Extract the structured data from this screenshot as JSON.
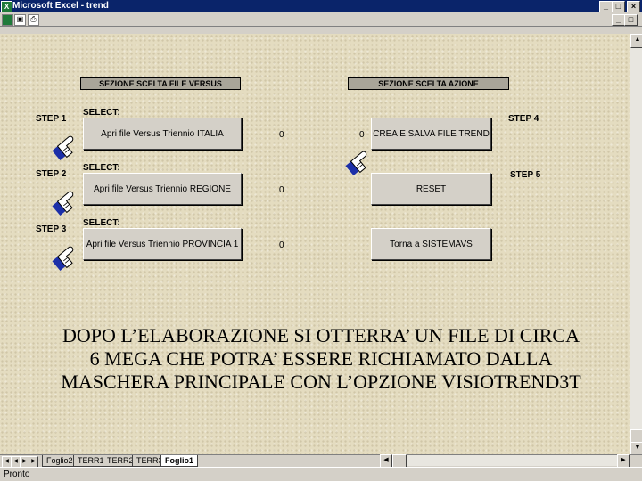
{
  "window": {
    "title": "Microsoft Excel - trend",
    "app_icon": "excel-icon",
    "controls": [
      "_",
      "□",
      "×"
    ]
  },
  "sections": {
    "left_header": "SEZIONE SCELTA FILE VERSUS",
    "right_header": "SEZIONE SCELTA AZIONE"
  },
  "left_rows": [
    {
      "step": "STEP 1",
      "select": "SELECT:",
      "button": "Apri file Versus Triennio ITALIA",
      "value": "0"
    },
    {
      "step": "STEP 2",
      "select": "SELECT:",
      "button": "Apri file Versus Triennio REGIONE",
      "value": "0"
    },
    {
      "step": "STEP 3",
      "select": "SELECT:",
      "button": "Apri file Versus Triennio PROVINCIA 1",
      "value": "0"
    }
  ],
  "right_rows": [
    {
      "step": "STEP 4",
      "value": "0",
      "button": "CREA E SALVA FILE TREND"
    },
    {
      "step": "STEP 5",
      "button": "RESET"
    },
    {
      "button": "Torna a SISTEMAVS"
    }
  ],
  "message": "DOPO L’ELABORAZIONE SI OTTERRA’ UN FILE DI CIRCA\n6 MEGA CHE POTRA’ ESSERE RICHIAMATO DALLA\nMASCHERA PRINCIPALE CON L’OPZIONE VISIOTREND3T",
  "sheet_tabs": [
    "Foglio2",
    "TERR1",
    "TERR2",
    "TERR3",
    "Foglio1"
  ],
  "active_tab": "Foglio1",
  "status": "Pronto",
  "colors": {
    "title_bar": "#0a246a",
    "sheet_bg": "#e4dcc0",
    "hand": "#1c2fa8"
  }
}
